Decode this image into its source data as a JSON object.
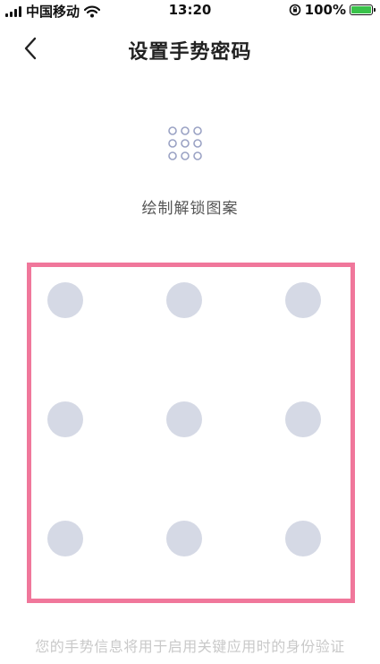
{
  "status_bar": {
    "carrier": "中国移动",
    "time": "13:20",
    "battery": "100%",
    "battery_level_percent": 100,
    "icons": [
      "signal-icon",
      "wifi-icon",
      "orientation-lock-icon",
      "battery-charging-icon"
    ]
  },
  "nav": {
    "title": "设置手势密码",
    "back_icon": "chevron-left-icon"
  },
  "pattern": {
    "icon": "pattern-grid-icon",
    "instruction": "绘制解锁图案",
    "dot_count": 9,
    "dot_color": "#d5d9e5",
    "highlight_border_color": "#f0779b"
  },
  "footer": {
    "note": "您的手势信息将用于启用关键应用时的身份验证"
  }
}
